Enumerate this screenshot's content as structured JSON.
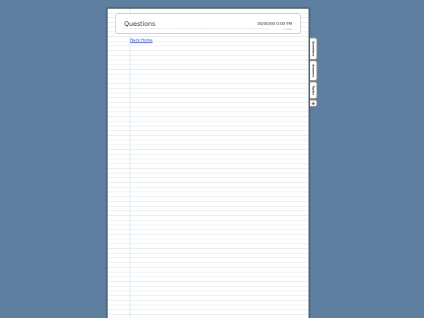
{
  "page": {
    "title": "Questions",
    "datetime": "00/00/00 0:00 PM",
    "subtext": "0 Views"
  },
  "nav": {
    "back_label": "Back Home"
  },
  "tabs": [
    {
      "label": "Questions"
    },
    {
      "label": "Answers"
    },
    {
      "label": "Topics"
    }
  ],
  "add_tab": {
    "label": "+"
  },
  "colors": {
    "background": "#5f7fa0",
    "link": "#2a44cc",
    "rule_line": "#e6eef2"
  }
}
